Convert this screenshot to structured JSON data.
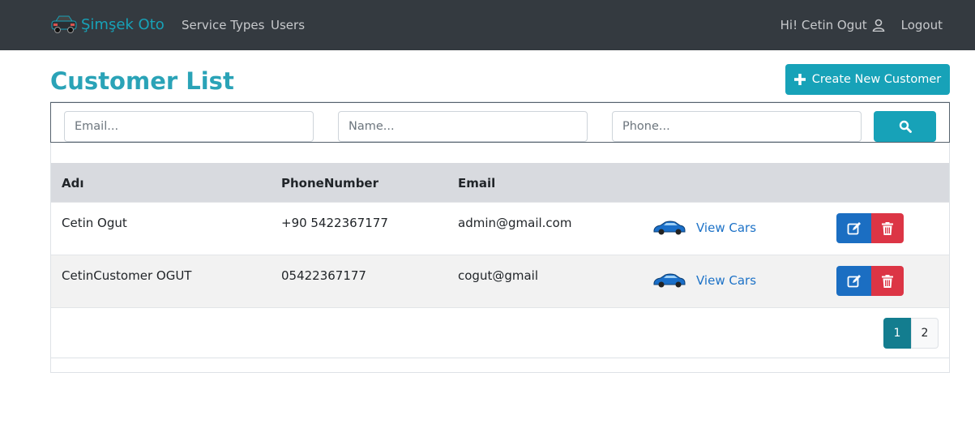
{
  "navbar": {
    "brand": "Şimşek Oto",
    "links": [
      "Service Types",
      "Users"
    ],
    "greeting": "Hi! Cetin Ogut",
    "logout": "Logout",
    "icons": {
      "brand": "car-logo-icon",
      "user": "user-icon"
    }
  },
  "header": {
    "title": "Customer List",
    "create_button": "Create New Customer"
  },
  "search": {
    "email_placeholder": "Email...",
    "name_placeholder": "Name...",
    "phone_placeholder": "Phone...",
    "icon": "search-icon"
  },
  "table": {
    "columns": [
      "Adı",
      "PhoneNumber",
      "Email"
    ],
    "rows": [
      {
        "name": "Cetin Ogut",
        "phone": "+90 5422367177",
        "email": "admin@gmail.com",
        "action": "View Cars"
      },
      {
        "name": "CetinCustomer OGUT",
        "phone": "05422367177",
        "email": "cogut@gmail",
        "action": "View Cars"
      }
    ]
  },
  "pagination": {
    "pages": [
      "1",
      "2"
    ],
    "current": "1"
  },
  "colors": {
    "navbar": "#343a40",
    "accent": "#17a2b8",
    "primary": "#1b6ec2",
    "danger": "#dc3545"
  }
}
